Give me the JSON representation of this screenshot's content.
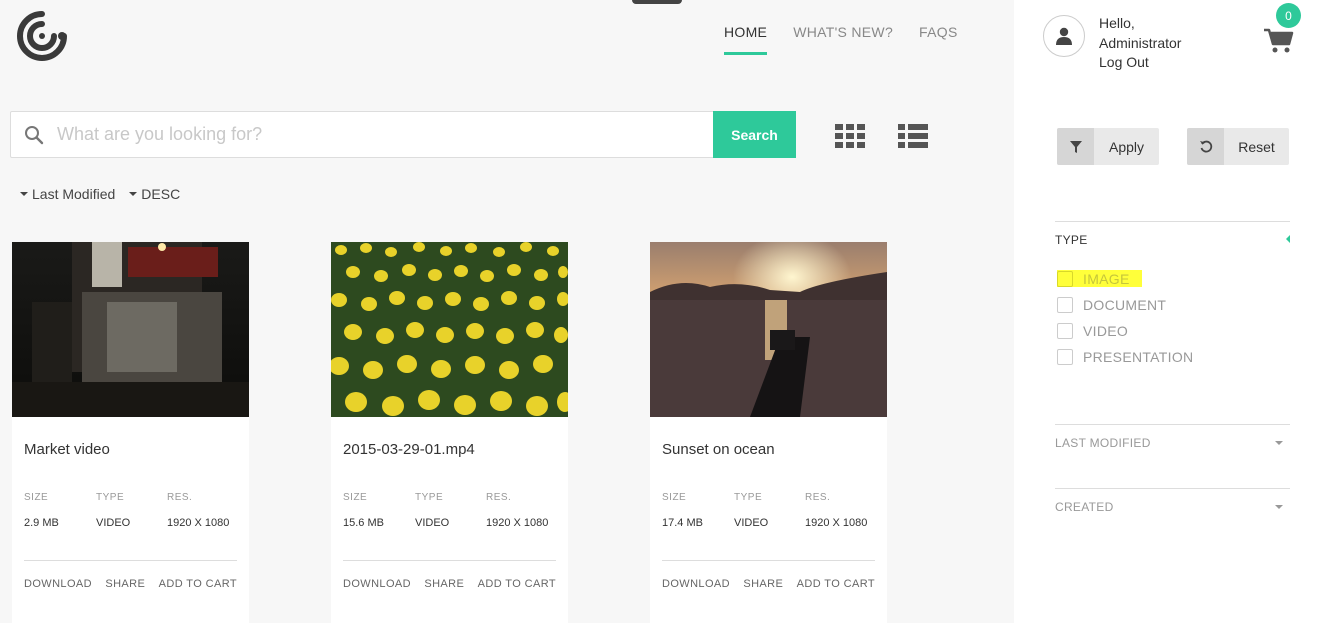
{
  "nav": {
    "items": [
      {
        "label": "HOME",
        "active": true
      },
      {
        "label": "WHAT'S NEW?",
        "active": false
      },
      {
        "label": "FAQS",
        "active": false
      }
    ]
  },
  "search": {
    "placeholder": "What are you looking for?",
    "value": "",
    "button_label": "Search"
  },
  "sort": {
    "field": "Last Modified",
    "direction": "DESC"
  },
  "cards": [
    {
      "title": "Market video",
      "size_label": "SIZE",
      "size": "2.9 MB",
      "type_label": "TYPE",
      "type": "VIDEO",
      "res_label": "RES.",
      "res": "1920 X 1080",
      "download": "DOWNLOAD",
      "share": "SHARE",
      "add_to_cart": "ADD TO CART"
    },
    {
      "title": "2015-03-29-01.mp4",
      "size_label": "SIZE",
      "size": "15.6 MB",
      "type_label": "TYPE",
      "type": "VIDEO",
      "res_label": "RES.",
      "res": "1920 X 1080",
      "download": "DOWNLOAD",
      "share": "SHARE",
      "add_to_cart": "ADD TO CART"
    },
    {
      "title": "Sunset on ocean",
      "size_label": "SIZE",
      "size": "17.4 MB",
      "type_label": "TYPE",
      "type": "VIDEO",
      "res_label": "RES.",
      "res": "1920 X 1080",
      "download": "DOWNLOAD",
      "share": "SHARE",
      "add_to_cart": "ADD TO CART"
    }
  ],
  "user": {
    "greeting": "Hello,",
    "name": "Administrator",
    "logout": "Log Out"
  },
  "cart": {
    "count": "0"
  },
  "filters": {
    "apply_label": "Apply",
    "reset_label": "Reset",
    "type_title": "TYPE",
    "type_options": [
      "IMAGE",
      "DOCUMENT",
      "VIDEO",
      "PRESENTATION"
    ],
    "last_modified_title": "LAST MODIFIED",
    "created_title": "CREATED"
  },
  "colors": {
    "accent": "#2ec99a",
    "highlight": "#ffff3a"
  },
  "icons": [
    "logo-icon",
    "search-icon",
    "grid-view-icon",
    "list-view-icon",
    "user-icon",
    "cart-icon",
    "filter-icon",
    "reset-icon"
  ]
}
